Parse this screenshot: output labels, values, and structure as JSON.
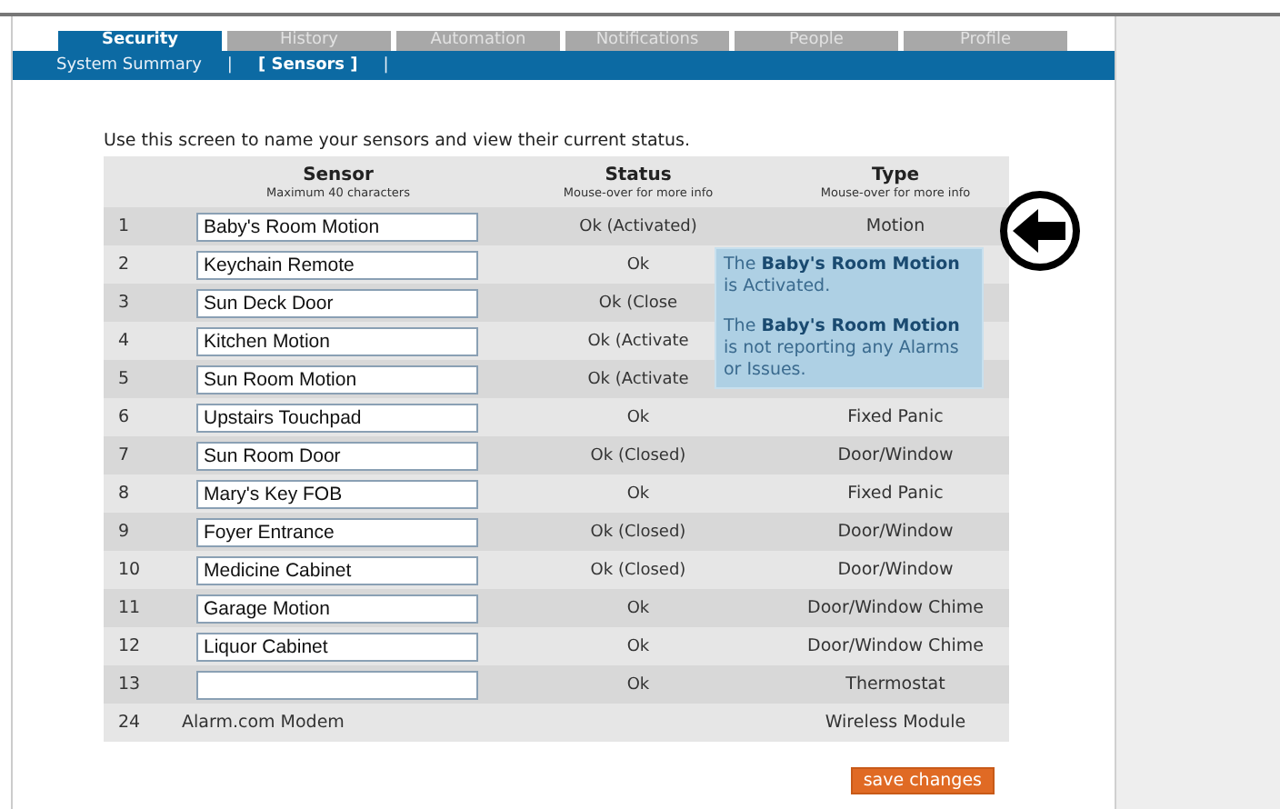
{
  "tabs": [
    {
      "label": "Security",
      "selected": true
    },
    {
      "label": "History",
      "selected": false
    },
    {
      "label": "Automation",
      "selected": false
    },
    {
      "label": "Notifications",
      "selected": false
    },
    {
      "label": "People",
      "selected": false
    },
    {
      "label": "Profile",
      "selected": false
    }
  ],
  "subnav": [
    {
      "kind": "link",
      "label": "System Summary",
      "selected": false
    },
    {
      "kind": "separator",
      "label": "|"
    },
    {
      "kind": "link",
      "label": "[ Sensors ]",
      "selected": true
    },
    {
      "kind": "separator",
      "label": "|"
    }
  ],
  "intro": "Use this screen to name your sensors and view their current status.",
  "table": {
    "columns": [
      {
        "title": "Sensor",
        "subtitle": "Maximum 40 characters"
      },
      {
        "title": "Status",
        "subtitle": "Mouse-over for more info"
      },
      {
        "title": "Type",
        "subtitle": "Mouse-over for more info"
      }
    ],
    "rows": [
      {
        "number": "1",
        "kind": "field",
        "name": "Baby's Room Motion",
        "status": "Ok (Activated)",
        "type": "Motion"
      },
      {
        "number": "2",
        "kind": "field",
        "name": "Keychain Remote",
        "status": "Ok"
      },
      {
        "number": "3",
        "kind": "field",
        "name": "Sun Deck Door",
        "status": "Ok (Close"
      },
      {
        "number": "4",
        "kind": "field",
        "name": "Kitchen Motion",
        "status": "Ok (Activate"
      },
      {
        "number": "5",
        "kind": "field",
        "name": "Sun Room Motion",
        "status": "Ok (Activate"
      },
      {
        "number": "6",
        "kind": "field",
        "name": "Upstairs Touchpad",
        "status": "Ok",
        "type": "Fixed Panic"
      },
      {
        "number": "7",
        "kind": "field",
        "name": "Sun Room Door",
        "status": "Ok (Closed)",
        "type": "Door/Window"
      },
      {
        "number": "8",
        "kind": "field",
        "name": "Mary's Key FOB",
        "status": "Ok",
        "type": "Fixed Panic"
      },
      {
        "number": "9",
        "kind": "field",
        "name": "Foyer Entrance",
        "status": "Ok (Closed)",
        "type": "Door/Window"
      },
      {
        "number": "10",
        "kind": "field",
        "name": "Medicine Cabinet",
        "status": "Ok (Closed)",
        "type": "Door/Window"
      },
      {
        "number": "11",
        "kind": "field",
        "name": "Garage Motion",
        "status": "Ok",
        "type": "Door/Window Chime"
      },
      {
        "number": "12",
        "kind": "field",
        "name": "Liquor Cabinet",
        "status": "Ok",
        "type": "Door/Window Chime"
      },
      {
        "number": "13",
        "kind": "field",
        "status": "Ok",
        "type": "Thermostat"
      },
      {
        "number": "24",
        "kind": "text",
        "name": "Alarm.com Modem",
        "type": "Wireless Module"
      }
    ]
  },
  "tooltip": {
    "paragraphs": [
      "The **Baby's Room Motion** is Activated.",
      "The **Baby's Room Motion** is not reporting any Alarms or Issues."
    ]
  },
  "save_button": "save changes"
}
